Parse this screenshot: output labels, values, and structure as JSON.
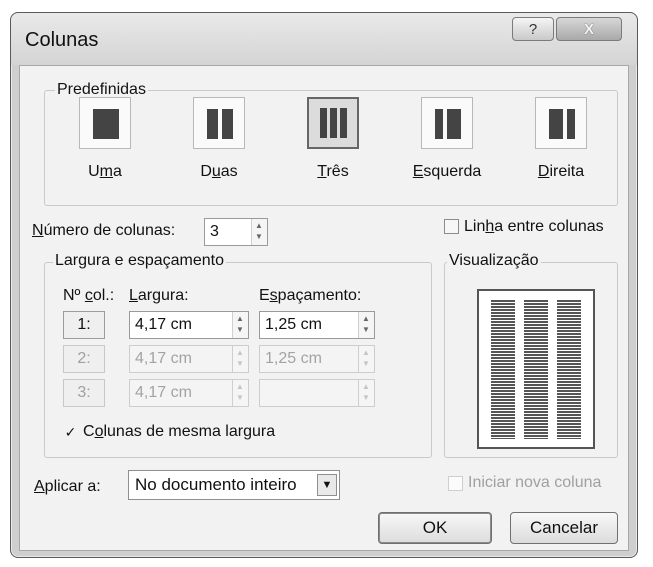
{
  "window": {
    "title": "Colunas",
    "help_glyph": "?",
    "close_glyph": "X"
  },
  "presets": {
    "title": "Predefinidas",
    "items": [
      {
        "id": "uma",
        "pre": "U",
        "key": "m",
        "post": "a",
        "columns": 1,
        "selected": false
      },
      {
        "id": "duas",
        "pre": "D",
        "key": "u",
        "post": "as",
        "columns": 2,
        "selected": false
      },
      {
        "id": "tres",
        "pre": "",
        "key": "T",
        "post": "rês",
        "columns": 3,
        "selected": true
      },
      {
        "id": "esquerda",
        "pre": "",
        "key": "E",
        "post": "squerda",
        "columns": "left",
        "selected": false
      },
      {
        "id": "direita",
        "pre": "",
        "key": "D",
        "post": "ireita",
        "columns": "right",
        "selected": false
      }
    ]
  },
  "numero": {
    "pre": "",
    "key": "N",
    "post": "úmero de colunas:",
    "value": "3"
  },
  "linha": {
    "pre": "Lin",
    "key": "h",
    "post": "a entre colunas",
    "checked": false
  },
  "largura": {
    "title": "Largura e espaçamento",
    "col_header_pre": "Nº ",
    "col_header_key": "c",
    "col_header_post": "ol.:",
    "width_header_key": "L",
    "width_header_post": "argura:",
    "spacing_header_pre": "E",
    "spacing_header_key": "s",
    "spacing_header_post": "paçamento:",
    "rows": [
      {
        "col": "1:",
        "width": "4,17 cm",
        "spacing": "1,25 cm",
        "enabled": true
      },
      {
        "col": "2:",
        "width": "4,17 cm",
        "spacing": "1,25 cm",
        "enabled": false
      },
      {
        "col": "3:",
        "width": "4,17 cm",
        "spacing": "",
        "enabled": false
      }
    ]
  },
  "mesma": {
    "check_glyph": "✓",
    "key": "o",
    "pre": "C",
    "post": "lunas de mesma largura",
    "checked": true
  },
  "visualizacao": {
    "title": "Visualização",
    "columns": 3
  },
  "aplicar": {
    "key": "A",
    "post": "plicar a:",
    "value": "No documento inteiro"
  },
  "iniciar": {
    "label": "Iniciar nova coluna",
    "checked": false
  },
  "buttons": {
    "ok": "OK",
    "cancel": "Cancelar"
  }
}
